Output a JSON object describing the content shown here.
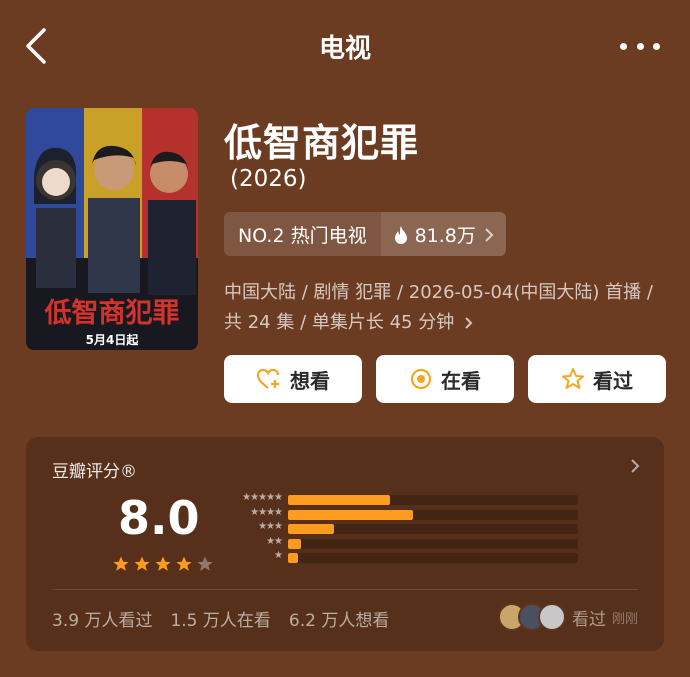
{
  "nav": {
    "title": "电视"
  },
  "poster": {
    "title_art": "低智商犯罪",
    "date_art": "5月4日起"
  },
  "show": {
    "title": "低智商犯罪",
    "year": "(2026)",
    "rank_label": "NO.2 热门电视",
    "heat": "81.8万",
    "meta": "中国大陆 / 剧情 犯罪 / 2026-05-04(中国大陆) 首播 / 共 24 集 / 单集片长 45 分钟"
  },
  "actions": {
    "want": "想看",
    "watching": "在看",
    "watched": "看过"
  },
  "rating": {
    "title": "豆瓣评分®",
    "score": "8.0",
    "stars": 4,
    "distribution": [
      0.35,
      0.43,
      0.16,
      0.045,
      0.035
    ],
    "stats": [
      "3.9 万人看过",
      "1.5 万人在看",
      "6.2 万人想看"
    ],
    "friends_label": "看过",
    "friends_time": "刚刚"
  },
  "colors": {
    "background": "#6b3b22",
    "accent": "#ff9b1f"
  }
}
